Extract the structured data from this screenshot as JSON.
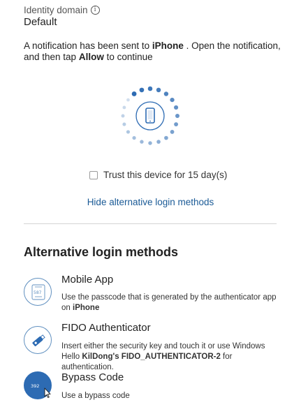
{
  "identity": {
    "label": "Identity domain",
    "info_icon": "info-icon",
    "value": "Default"
  },
  "notification": {
    "prefix": "A notification has been sent to ",
    "device": "iPhone",
    "middle": " . Open the notification, and then tap ",
    "action": "Allow",
    "suffix": " to continue"
  },
  "spinner": {
    "icon": "smartphone-icon",
    "accent": "#2d6bb3"
  },
  "trust": {
    "label": "Trust this device for 15 day(s)",
    "checked": false
  },
  "hide_link": "Hide alternative login methods",
  "alt": {
    "heading": "Alternative login methods",
    "methods": [
      {
        "title": "Mobile App",
        "desc_prefix": "Use the passcode that is generated by the authenticator app on ",
        "desc_bold": "iPhone",
        "desc_suffix": "",
        "icon": "authenticator-app-icon",
        "icon_text": "587"
      },
      {
        "title": "FIDO Authenticator",
        "desc_prefix": "Insert either the security key and touch it or use Windows Hello ",
        "desc_bold": "KilDong's FIDO_AUTHENTICATOR-2",
        "desc_suffix": " for authentication.",
        "icon": "security-key-icon"
      },
      {
        "title": "Bypass Code",
        "desc_prefix": "Use a bypass code",
        "desc_bold": "",
        "desc_suffix": "",
        "icon": "bypass-code-icon",
        "icon_text": "392"
      }
    ]
  }
}
